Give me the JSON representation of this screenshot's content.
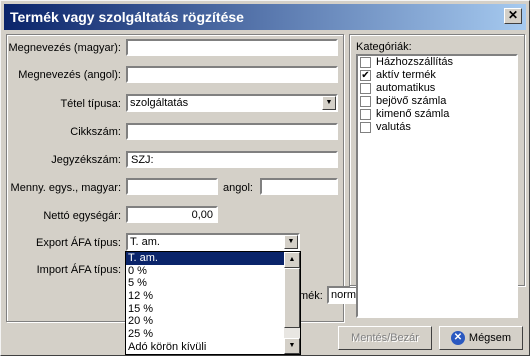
{
  "window": {
    "title": "Termék vagy szolgáltatás rögzítése",
    "close_label": "✕"
  },
  "form": {
    "name_hu_label": "Megnevezés (magyar):",
    "name_hu_value": "",
    "name_en_label": "Megnevezés (angol):",
    "name_en_value": "",
    "item_type_label": "Tétel típusa:",
    "item_type_value": "szolgáltatás",
    "item_no_label": "Cikkszám:",
    "item_no_value": "",
    "note_no_label": "Jegyzékszám:",
    "note_no_value": "SZJ:",
    "unit_hu_label": "Menny. egys., magyar:",
    "unit_hu_value": "",
    "unit_en_label": "angol:",
    "unit_en_value": "",
    "net_price_label": "Nettó egységár:",
    "net_price_value": "0,00",
    "export_vat_label": "Export ÁFA típus:",
    "export_vat_value": "T. am.",
    "import_vat_label": "Import ÁFA típus:",
    "special_type_label_partial": "mék:",
    "special_type_value": "normál termék (nem speciális)"
  },
  "categories": {
    "label": "Kategóriák:",
    "items": [
      {
        "label": "Házhozszállítás",
        "checked": false
      },
      {
        "label": "aktív termék",
        "checked": true
      },
      {
        "label": "automatikus",
        "checked": false
      },
      {
        "label": "bejövő számla",
        "checked": false
      },
      {
        "label": "kimenő számla",
        "checked": false
      },
      {
        "label": "valutás",
        "checked": false
      }
    ]
  },
  "vat_dropdown": {
    "options": [
      "T. am.",
      "0 %",
      "5 %",
      "12 %",
      "15 %",
      "20 %",
      "25 %",
      "Adó körön kívüli"
    ],
    "selected_index": 0
  },
  "buttons": {
    "save_label": "Mentés/Bezár",
    "cancel_label": "Mégsem"
  },
  "icons": {
    "checkbox_checked": "✔",
    "arrow_down": "▼",
    "arrow_up": "▲",
    "close": "✕"
  }
}
